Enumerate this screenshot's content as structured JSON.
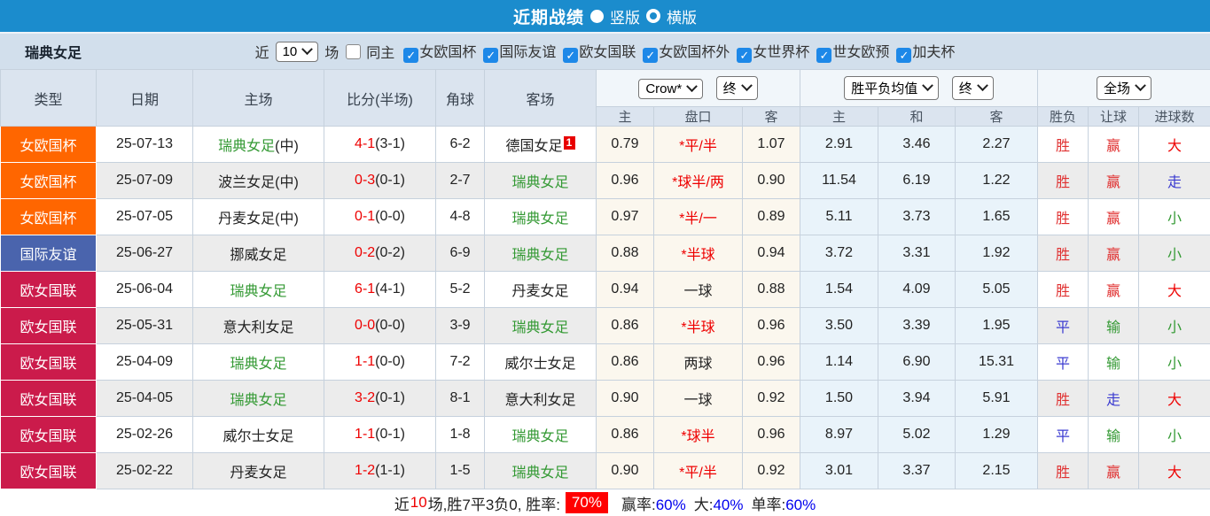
{
  "title_bar": {
    "title": "近期战绩",
    "radio_vertical_label": "竖版",
    "radio_horizontal_label": "横版",
    "radio_selected": "竖版"
  },
  "filter_bar": {
    "team": "瑞典女足",
    "near_label": "近",
    "count_value": "10",
    "games_label": "场",
    "same_home_label": "同主",
    "same_home_checked": false,
    "competitions": [
      {
        "label": "女欧国杯",
        "checked": true
      },
      {
        "label": "国际友谊",
        "checked": true
      },
      {
        "label": "欧女国联",
        "checked": true
      },
      {
        "label": "女欧国杯外",
        "checked": true
      },
      {
        "label": "女世界杯",
        "checked": true
      },
      {
        "label": "世女欧预",
        "checked": true
      },
      {
        "label": "加夫杯",
        "checked": true
      }
    ]
  },
  "table": {
    "headers_left": [
      "类型",
      "日期",
      "主场",
      "比分(半场)",
      "角球",
      "客场"
    ],
    "dropdowns": {
      "odds_company": "Crow*",
      "odds_company_time": "终",
      "avg_label": "胜平负均值",
      "avg_time": "终",
      "scope": "全场"
    },
    "subheaders": [
      "主",
      "盘口",
      "客",
      "主",
      "和",
      "客",
      "胜负",
      "让球",
      "进球数"
    ],
    "type_colors": {
      "女欧国杯": "#ff6600",
      "国际友谊": "#4a64ad",
      "欧女国联": "#cb1b4b"
    },
    "rows": [
      {
        "type": "女欧国杯",
        "date": "25-07-13",
        "home": "瑞典女足",
        "home_suffix": "(中)",
        "home_subject": true,
        "score": "4-1",
        "half": "(3-1)",
        "corner": "6-2",
        "away": "德国女足",
        "away_badge": "1",
        "away_subject": false,
        "odds_home": "0.79",
        "handicap": "*平/半",
        "handicap_red": true,
        "odds_away": "1.07",
        "avg_win": "2.91",
        "avg_draw": "3.46",
        "avg_lose": "2.27",
        "result": "胜",
        "result_color": "red",
        "let_result": "赢",
        "let_color": "red",
        "goals": "大",
        "goals_color": "red"
      },
      {
        "type": "女欧国杯",
        "date": "25-07-09",
        "home": "波兰女足",
        "home_suffix": "(中)",
        "home_subject": false,
        "score": "0-3",
        "half": "(0-1)",
        "corner": "2-7",
        "away": "瑞典女足",
        "away_badge": "",
        "away_subject": true,
        "odds_home": "0.96",
        "handicap": "*球半/两",
        "handicap_red": true,
        "odds_away": "0.90",
        "avg_win": "11.54",
        "avg_draw": "6.19",
        "avg_lose": "1.22",
        "result": "胜",
        "result_color": "red",
        "let_result": "赢",
        "let_color": "red",
        "goals": "走",
        "goals_color": "blue"
      },
      {
        "type": "女欧国杯",
        "date": "25-07-05",
        "home": "丹麦女足",
        "home_suffix": "(中)",
        "home_subject": false,
        "score": "0-1",
        "half": "(0-0)",
        "corner": "4-8",
        "away": "瑞典女足",
        "away_badge": "",
        "away_subject": true,
        "odds_home": "0.97",
        "handicap": "*半/一",
        "handicap_red": true,
        "odds_away": "0.89",
        "avg_win": "5.11",
        "avg_draw": "3.73",
        "avg_lose": "1.65",
        "result": "胜",
        "result_color": "red",
        "let_result": "赢",
        "let_color": "red",
        "goals": "小",
        "goals_color": "green"
      },
      {
        "type": "国际友谊",
        "date": "25-06-27",
        "home": "挪威女足",
        "home_suffix": "",
        "home_subject": false,
        "score": "0-2",
        "half": "(0-2)",
        "corner": "6-9",
        "away": "瑞典女足",
        "away_badge": "",
        "away_subject": true,
        "odds_home": "0.88",
        "handicap": "*半球",
        "handicap_red": true,
        "odds_away": "0.94",
        "avg_win": "3.72",
        "avg_draw": "3.31",
        "avg_lose": "1.92",
        "result": "胜",
        "result_color": "red",
        "let_result": "赢",
        "let_color": "red",
        "goals": "小",
        "goals_color": "green"
      },
      {
        "type": "欧女国联",
        "date": "25-06-04",
        "home": "瑞典女足",
        "home_suffix": "",
        "home_subject": true,
        "score": "6-1",
        "half": "(4-1)",
        "corner": "5-2",
        "away": "丹麦女足",
        "away_badge": "",
        "away_subject": false,
        "odds_home": "0.94",
        "handicap": "一球",
        "handicap_red": false,
        "odds_away": "0.88",
        "avg_win": "1.54",
        "avg_draw": "4.09",
        "avg_lose": "5.05",
        "result": "胜",
        "result_color": "red",
        "let_result": "赢",
        "let_color": "red",
        "goals": "大",
        "goals_color": "red"
      },
      {
        "type": "欧女国联",
        "date": "25-05-31",
        "home": "意大利女足",
        "home_suffix": "",
        "home_subject": false,
        "score": "0-0",
        "half": "(0-0)",
        "corner": "3-9",
        "away": "瑞典女足",
        "away_badge": "",
        "away_subject": true,
        "odds_home": "0.86",
        "handicap": "*半球",
        "handicap_red": true,
        "odds_away": "0.96",
        "avg_win": "3.50",
        "avg_draw": "3.39",
        "avg_lose": "1.95",
        "result": "平",
        "result_color": "blue",
        "let_result": "输",
        "let_color": "green",
        "goals": "小",
        "goals_color": "green"
      },
      {
        "type": "欧女国联",
        "date": "25-04-09",
        "home": "瑞典女足",
        "home_suffix": "",
        "home_subject": true,
        "score": "1-1",
        "half": "(0-0)",
        "corner": "7-2",
        "away": "威尔士女足",
        "away_badge": "",
        "away_subject": false,
        "odds_home": "0.86",
        "handicap": "两球",
        "handicap_red": false,
        "odds_away": "0.96",
        "avg_win": "1.14",
        "avg_draw": "6.90",
        "avg_lose": "15.31",
        "result": "平",
        "result_color": "blue",
        "let_result": "输",
        "let_color": "green",
        "goals": "小",
        "goals_color": "green"
      },
      {
        "type": "欧女国联",
        "date": "25-04-05",
        "home": "瑞典女足",
        "home_suffix": "",
        "home_subject": true,
        "score": "3-2",
        "half": "(0-1)",
        "corner": "8-1",
        "away": "意大利女足",
        "away_badge": "",
        "away_subject": false,
        "odds_home": "0.90",
        "handicap": "一球",
        "handicap_red": false,
        "odds_away": "0.92",
        "avg_win": "1.50",
        "avg_draw": "3.94",
        "avg_lose": "5.91",
        "result": "胜",
        "result_color": "red",
        "let_result": "走",
        "let_color": "blue",
        "goals": "大",
        "goals_color": "red"
      },
      {
        "type": "欧女国联",
        "date": "25-02-26",
        "home": "威尔士女足",
        "home_suffix": "",
        "home_subject": false,
        "score": "1-1",
        "half": "(0-1)",
        "corner": "1-8",
        "away": "瑞典女足",
        "away_badge": "",
        "away_subject": true,
        "odds_home": "0.86",
        "handicap": "*球半",
        "handicap_red": true,
        "odds_away": "0.96",
        "avg_win": "8.97",
        "avg_draw": "5.02",
        "avg_lose": "1.29",
        "result": "平",
        "result_color": "blue",
        "let_result": "输",
        "let_color": "green",
        "goals": "小",
        "goals_color": "green"
      },
      {
        "type": "欧女国联",
        "date": "25-02-22",
        "home": "丹麦女足",
        "home_suffix": "",
        "home_subject": false,
        "score": "1-2",
        "half": "(1-1)",
        "corner": "1-5",
        "away": "瑞典女足",
        "away_badge": "",
        "away_subject": true,
        "odds_home": "0.90",
        "handicap": "*平/半",
        "handicap_red": true,
        "odds_away": "0.92",
        "avg_win": "3.01",
        "avg_draw": "3.37",
        "avg_lose": "2.15",
        "result": "胜",
        "result_color": "red",
        "let_result": "赢",
        "let_color": "red",
        "goals": "大",
        "goals_color": "red"
      }
    ]
  },
  "footer": {
    "prefix": "近",
    "count": "10",
    "middle": "场,胜7平3负0, 胜率:",
    "win_rate": "70%",
    "stats": [
      {
        "label": "赢率:",
        "value": "60%"
      },
      {
        "label": "大:",
        "value": "40%"
      },
      {
        "label": "单率:",
        "value": "60%"
      }
    ]
  },
  "colors": {
    "title_bar_bg": "#1b8ccd",
    "filter_bar_bg": "#d2dfec",
    "header_bg": "#dbe4ef",
    "type_orange": "#ff6600",
    "type_blue": "#4a64ad",
    "type_crimson": "#cb1b4b",
    "subject_team_green": "#339933",
    "score_red": "#ee0000",
    "result_blue": "#3b3bd0",
    "win_rate_badge_bg": "#ff0000",
    "footer_value_blue": "#0000ee"
  }
}
